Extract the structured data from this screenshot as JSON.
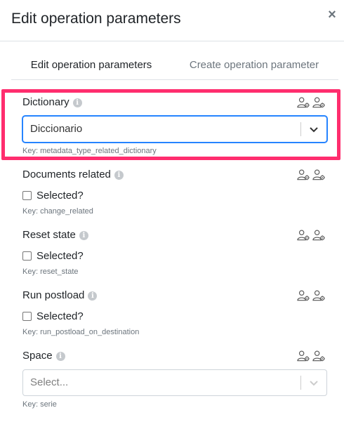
{
  "modal": {
    "title": "Edit operation parameters",
    "close_glyph": "×"
  },
  "tabs": [
    {
      "label": "Edit operation parameters",
      "active": true
    },
    {
      "label": "Create operation parameter",
      "active": false
    }
  ],
  "fields": {
    "dictionary": {
      "label": "Dictionary",
      "value": "Diccionario",
      "key": "Key:  metadata_type_related_dictionary"
    },
    "documents_related": {
      "label": "Documents related",
      "checkbox_label": "Selected?",
      "key": "Key:  change_related"
    },
    "reset_state": {
      "label": "Reset state",
      "checkbox_label": "Selected?",
      "key": "Key:  reset_state"
    },
    "run_postload": {
      "label": "Run postload",
      "checkbox_label": "Selected?",
      "key": "Key:  run_postload_on_destination"
    },
    "space": {
      "label": "Space",
      "placeholder": "Select...",
      "key": "Key:  serie"
    }
  },
  "colors": {
    "highlight": "#ff2d6e",
    "focus_border": "#2684ff",
    "muted": "#6c757d"
  },
  "icons": {
    "info": "info-icon",
    "user_settings": "user-cog-icon",
    "chevron": "chevron-down-icon",
    "close": "close-icon"
  }
}
